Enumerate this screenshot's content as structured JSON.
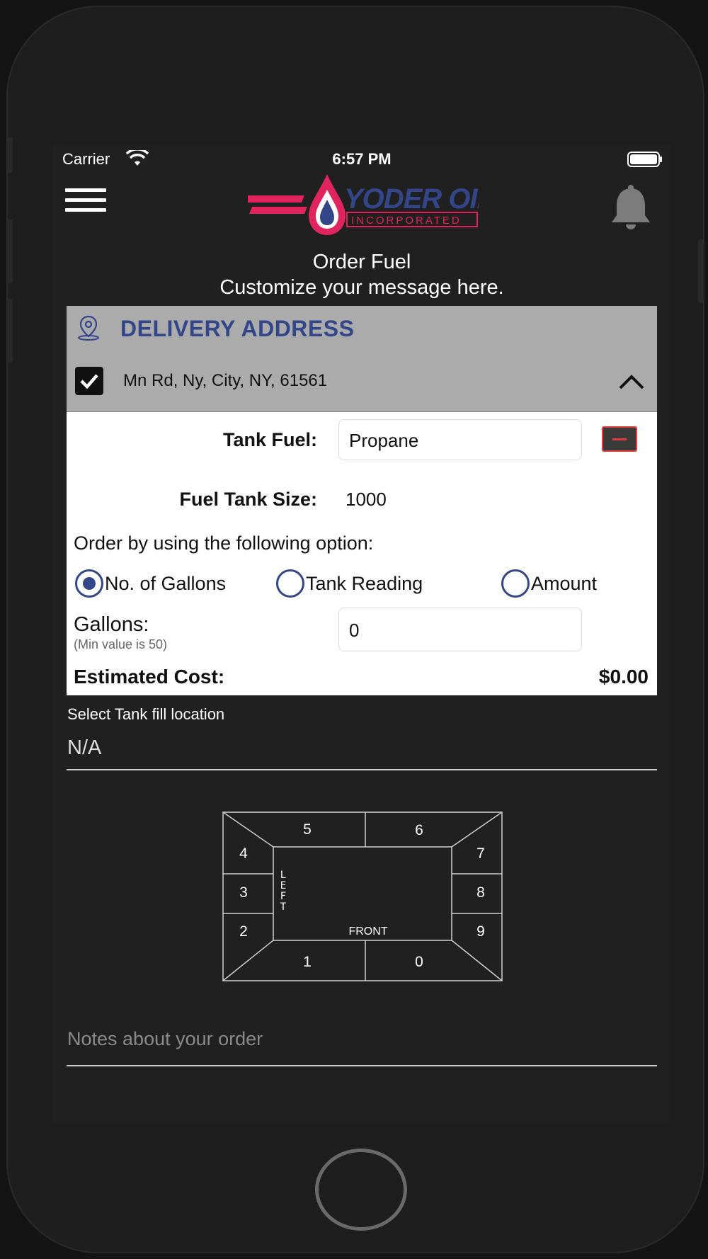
{
  "status_bar": {
    "carrier": "Carrier",
    "time": "6:57 PM"
  },
  "header": {
    "logo_name": "YODER OIL",
    "logo_sub": "INCORPORATED",
    "menu_icon": "hamburger-menu-icon",
    "bell_icon": "bell-icon"
  },
  "page": {
    "title": "Order Fuel",
    "subtitle": "Customize your message here."
  },
  "delivery": {
    "header": "DELIVERY ADDRESS",
    "address": "Mn Rd, Ny, City, NY, 61561",
    "checked": true
  },
  "form": {
    "tank_fuel_label": "Tank Fuel:",
    "tank_fuel_value": "Propane",
    "tank_size_label": "Fuel Tank Size:",
    "tank_size_value": "1000",
    "order_option_label": "Order by using the following option:",
    "options": [
      {
        "label": "No. of Gallons",
        "selected": true
      },
      {
        "label": "Tank Reading",
        "selected": false
      },
      {
        "label": "Amount",
        "selected": false
      }
    ],
    "gallons_label": "Gallons:",
    "gallons_hint": "(Min value is 50)",
    "gallons_value": "0",
    "estimated_label": "Estimated Cost:",
    "estimated_value": "$0.00"
  },
  "fill_location": {
    "label": "Select Tank fill location",
    "value": "N/A",
    "zones": [
      "5",
      "6",
      "4",
      "7",
      "3",
      "8",
      "2",
      "9",
      "1",
      "0"
    ],
    "left_text": "LEFT",
    "front_text": "FRONT"
  },
  "notes": {
    "placeholder": "Notes about your order"
  },
  "colors": {
    "brand_blue": "#34468a",
    "brand_red": "#e0245e",
    "accent_minus": "#e23b3b"
  }
}
